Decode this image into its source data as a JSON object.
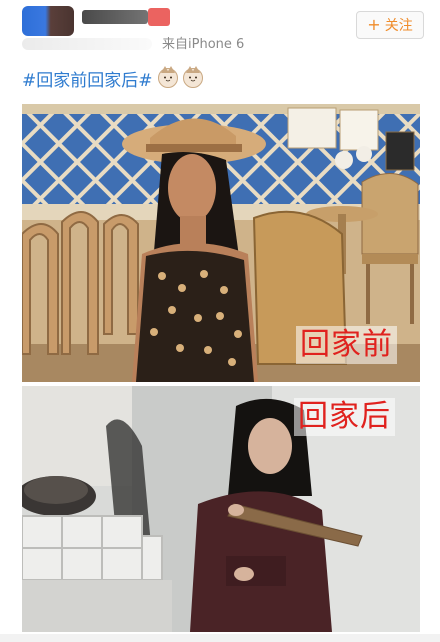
{
  "header": {
    "source": "来自iPhone 6",
    "follow_label": "关注",
    "follow_icon": "plus-icon"
  },
  "post": {
    "hashtag": "#回家前回家后#",
    "emojis": [
      "cat-face-icon",
      "cat-face-icon"
    ]
  },
  "photos": [
    {
      "caption": "回家前"
    },
    {
      "caption": "回家后"
    }
  ],
  "colors": {
    "hashtag": "#2e7bcf",
    "follow_accent": "#f08c2a",
    "caption_red": "#e0221e"
  }
}
